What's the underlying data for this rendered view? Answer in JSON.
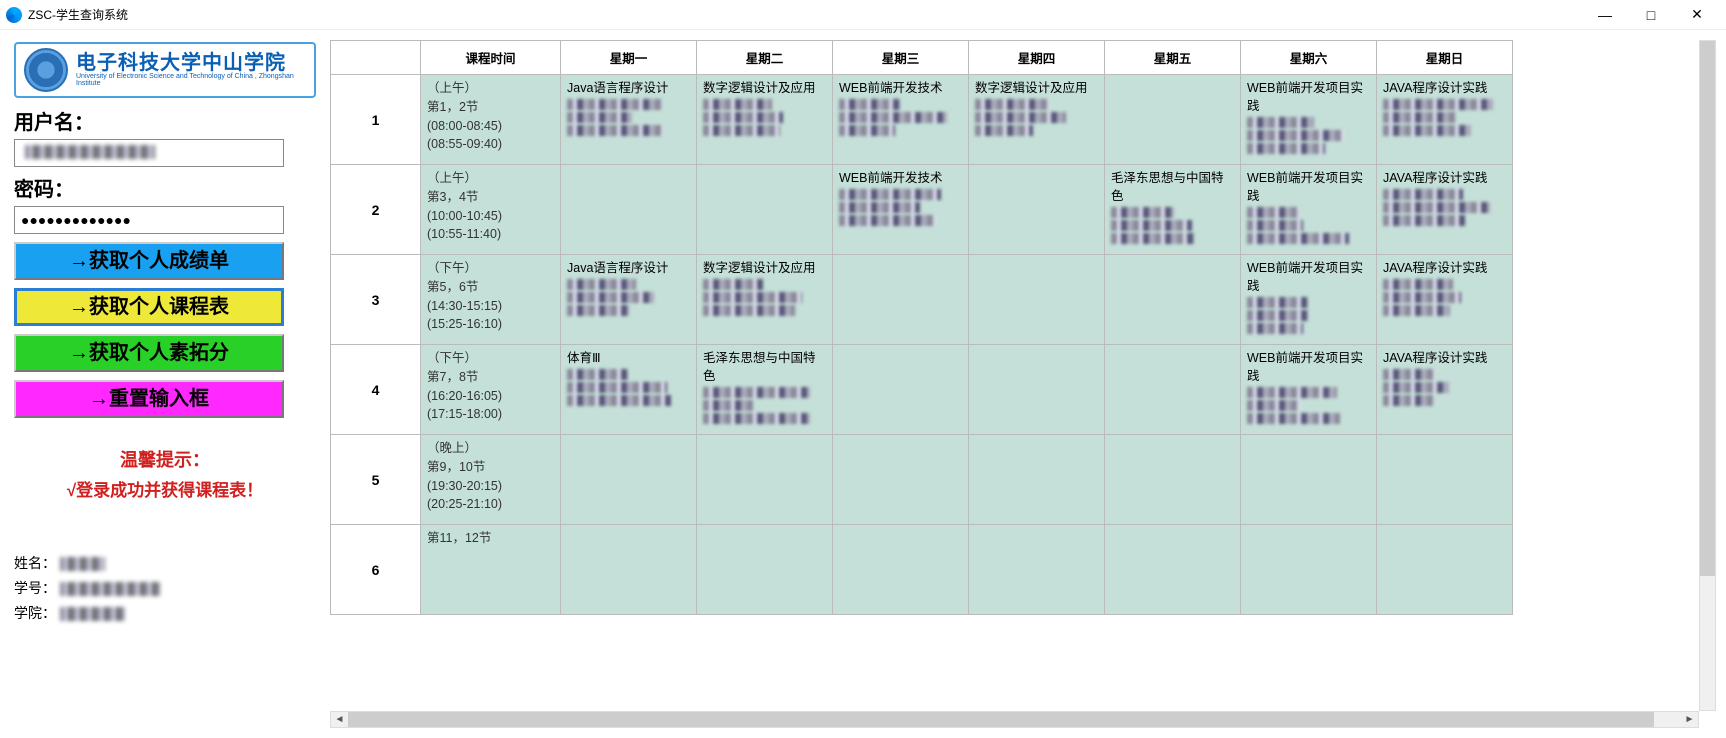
{
  "window": {
    "title": "ZSC-学生查询系统"
  },
  "logo": {
    "zh": "电子科技大学中山学院",
    "en": "University of Electronic Science and Technology of China , Zhongshan Institute"
  },
  "form": {
    "user_label": "用户名：",
    "pass_label": "密码：",
    "pass_value": "●●●●●●●●●●●●●"
  },
  "buttons": {
    "grades": "→获取个人成绩单",
    "schedule": "→获取个人课程表",
    "points": "→获取个人素拓分",
    "reset": "→重置输入框"
  },
  "hint": {
    "l1": "温馨提示：",
    "l2": "√登录成功并获得课程表！"
  },
  "info": {
    "name_label": "姓名：",
    "id_label": "学号：",
    "college_label": "学院："
  },
  "headers": [
    "",
    "课程时间",
    "星期一",
    "星期二",
    "星期三",
    "星期四",
    "星期五",
    "星期六",
    "星期日"
  ],
  "periods": [
    {
      "num": "1",
      "time": "（上午）\n第1，2节\n(08:00-08:45)\n(08:55-09:40)",
      "cells": [
        "Java语言程序设计",
        "数字逻辑设计及应用",
        "WEB前端开发技术",
        "数字逻辑设计及应用",
        "",
        "WEB前端开发项目实践",
        "JAVA程序设计实践"
      ]
    },
    {
      "num": "2",
      "time": "（上午）\n第3，4节\n(10:00-10:45)\n(10:55-11:40)",
      "cells": [
        "",
        "",
        "WEB前端开发技术",
        "",
        "毛泽东思想与中国特色",
        "WEB前端开发项目实践",
        "JAVA程序设计实践"
      ]
    },
    {
      "num": "3",
      "time": "（下午）\n第5，6节\n(14:30-15:15)\n(15:25-16:10)",
      "cells": [
        "Java语言程序设计",
        "数字逻辑设计及应用",
        "",
        "",
        "",
        "WEB前端开发项目实践",
        "JAVA程序设计实践"
      ]
    },
    {
      "num": "4",
      "time": "（下午）\n第7，8节\n(16:20-16:05)\n(17:15-18:00)",
      "cells": [
        "体育Ⅲ",
        "毛泽东思想与中国特色",
        "",
        "",
        "",
        "WEB前端开发项目实践",
        "JAVA程序设计实践"
      ]
    },
    {
      "num": "5",
      "time": "（晚上）\n第9，10节\n(19:30-20:15)\n(20:25-21:10)",
      "cells": [
        "",
        "",
        "",
        "",
        "",
        "",
        ""
      ]
    },
    {
      "num": "6",
      "time": "第11，12节",
      "cells": [
        "",
        "",
        "",
        "",
        "",
        "",
        ""
      ]
    }
  ]
}
